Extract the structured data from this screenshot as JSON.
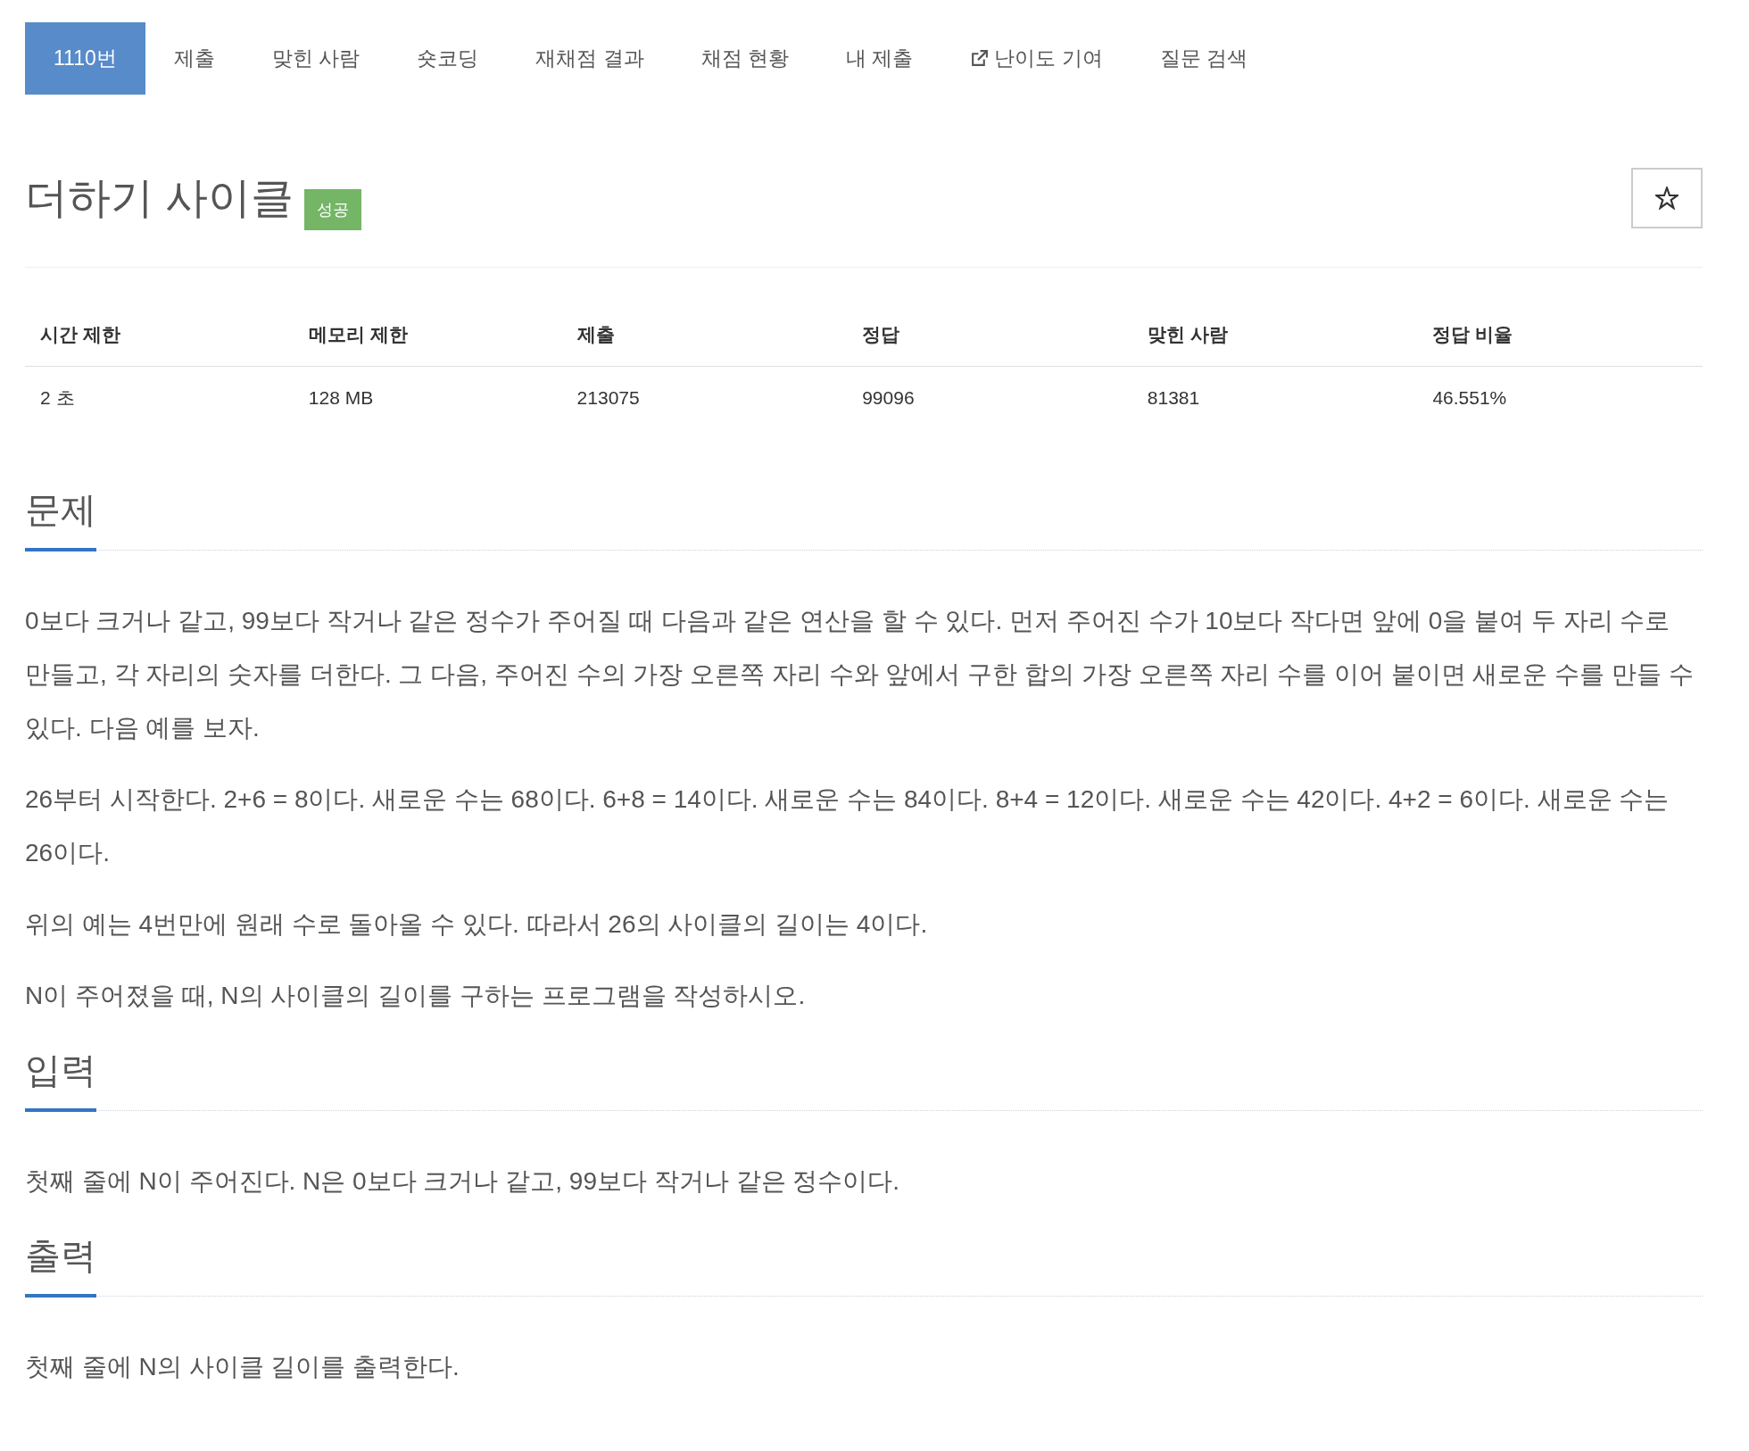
{
  "tabs": [
    {
      "label": "1110번",
      "selected": true,
      "external": false
    },
    {
      "label": "제출",
      "selected": false,
      "external": false
    },
    {
      "label": "맞힌 사람",
      "selected": false,
      "external": false
    },
    {
      "label": "숏코딩",
      "selected": false,
      "external": false
    },
    {
      "label": "재채점 결과",
      "selected": false,
      "external": false
    },
    {
      "label": "채점 현황",
      "selected": false,
      "external": false
    },
    {
      "label": "내 제출",
      "selected": false,
      "external": false
    },
    {
      "label": "난이도 기여",
      "selected": false,
      "external": true
    },
    {
      "label": "질문 검색",
      "selected": false,
      "external": false
    }
  ],
  "problem": {
    "title": "더하기 사이클",
    "result_badge": "성공",
    "starred": false
  },
  "stats": {
    "columns": [
      "시간 제한",
      "메모리 제한",
      "제출",
      "정답",
      "맞힌 사람",
      "정답 비율"
    ],
    "rows": [
      [
        "2 초",
        "128 MB",
        "213075",
        "99096",
        "81381",
        "46.551%"
      ]
    ]
  },
  "sections": [
    {
      "heading": "문제",
      "paragraphs": [
        "0보다 크거나 같고, 99보다 작거나 같은 정수가 주어질 때 다음과 같은 연산을 할 수 있다. 먼저 주어진 수가 10보다 작다면 앞에 0을 붙여 두 자리 수로 만들고, 각 자리의 숫자를 더한다. 그 다음, 주어진 수의 가장 오른쪽 자리 수와 앞에서 구한 합의 가장 오른쪽 자리 수를 이어 붙이면 새로운 수를 만들 수 있다. 다음 예를 보자.",
        "26부터 시작한다. 2+6 = 8이다. 새로운 수는 68이다. 6+8 = 14이다. 새로운 수는 84이다. 8+4 = 12이다. 새로운 수는 42이다. 4+2 = 6이다. 새로운 수는 26이다.",
        "위의 예는 4번만에 원래 수로 돌아올 수 있다. 따라서 26의 사이클의 길이는 4이다.",
        "N이 주어졌을 때, N의 사이클의 길이를 구하는 프로그램을 작성하시오."
      ]
    },
    {
      "heading": "입력",
      "paragraphs": [
        "첫째 줄에 N이 주어진다. N은 0보다 크거나 같고, 99보다 작거나 같은 정수이다."
      ]
    },
    {
      "heading": "출력",
      "paragraphs": [
        "첫째 줄에 N의 사이클 길이를 출력한다."
      ]
    }
  ]
}
